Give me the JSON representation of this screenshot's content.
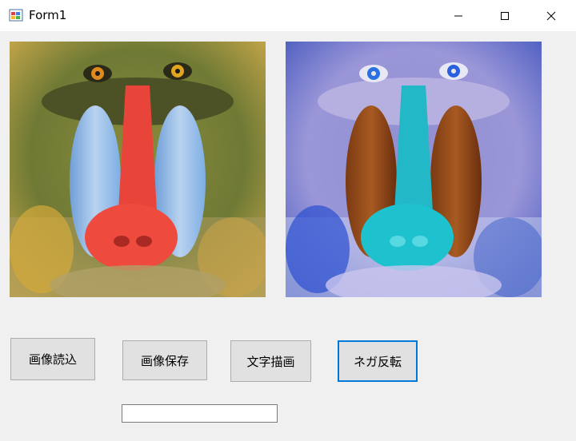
{
  "window": {
    "title": "Form1",
    "minimize_icon": "minimize-icon",
    "maximize_icon": "maximize-icon",
    "close_icon": "close-icon"
  },
  "pictures": {
    "original": "mandrill-photo",
    "negative": "mandrill-photo-negative"
  },
  "buttons": {
    "load_label": "画像読込",
    "save_label": "画像保存",
    "draw_text_label": "文字描画",
    "negate_label": "ネガ反転"
  },
  "textbox": {
    "value": ""
  },
  "colors": {
    "focus_border": "#0078d7",
    "button_face": "#e1e1e1",
    "form_background": "#f0f0f0"
  }
}
